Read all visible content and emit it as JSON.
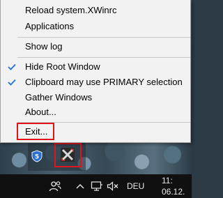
{
  "menu": {
    "items": [
      {
        "label": "Reload system.XWinrc",
        "checked": false
      },
      {
        "label": "Applications",
        "checked": false
      },
      {
        "label": "Show log",
        "checked": false
      },
      {
        "label": "Hide Root Window",
        "checked": true
      },
      {
        "label": "Clipboard may use PRIMARY selection",
        "checked": true
      },
      {
        "label": "Gather Windows",
        "checked": false
      },
      {
        "label": "About...",
        "checked": false
      },
      {
        "label": "Exit...",
        "checked": false
      }
    ]
  },
  "tray": {
    "language": "DEU",
    "time": "11:",
    "date": "06.12."
  },
  "colors": {
    "highlight_box": "#e0141b",
    "check": "#1e6fd9",
    "taskbar": "#101010",
    "menu_bg": "#f2f2f2"
  },
  "icons": [
    "shield-icon",
    "xwin-icon",
    "people-icon",
    "chevron-up-icon",
    "network-icon",
    "volume-muted-icon",
    "check-icon"
  ]
}
